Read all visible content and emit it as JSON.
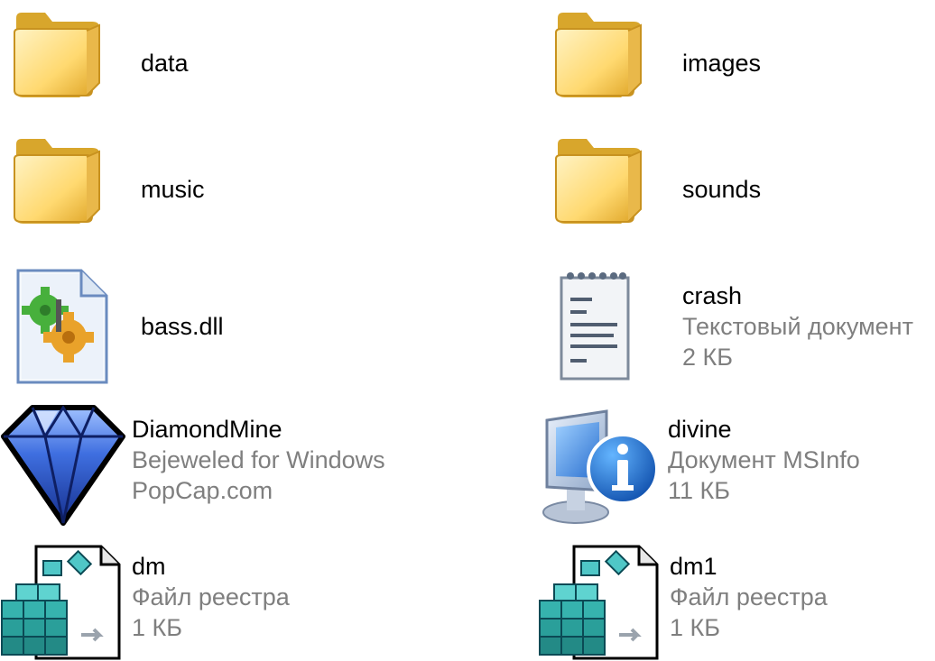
{
  "window": {
    "view": "tiles"
  },
  "colors": {
    "folder_light": "#ffe08a",
    "folder_dark": "#d8a62c",
    "secondary_text": "#7f7f7f",
    "diamond_blue": "#1f48c8",
    "info_blue": "#1565c0"
  },
  "files": [
    {
      "name": "data",
      "type": "",
      "detail": "",
      "icon": "folder-icon"
    },
    {
      "name": "images",
      "type": "",
      "detail": "",
      "icon": "folder-icon"
    },
    {
      "name": "music",
      "type": "",
      "detail": "",
      "icon": "folder-icon"
    },
    {
      "name": "sounds",
      "type": "",
      "detail": "",
      "icon": "folder-icon"
    },
    {
      "name": "bass.dll",
      "type": "",
      "detail": "",
      "icon": "dll-file-icon"
    },
    {
      "name": "crash",
      "type": "Текстовый документ",
      "detail": "2 КБ",
      "icon": "text-document-icon"
    },
    {
      "name": "DiamondMine",
      "type": "Bejeweled for Windows",
      "detail": "PopCap.com",
      "icon": "diamond-icon"
    },
    {
      "name": "divine",
      "type": "Документ MSInfo",
      "detail": "11 КБ",
      "icon": "msinfo-icon"
    },
    {
      "name": "dm",
      "type": "Файл реестра",
      "detail": "1 КБ",
      "icon": "registry-file-icon"
    },
    {
      "name": "dm1",
      "type": "Файл реестра",
      "detail": "1 КБ",
      "icon": "registry-file-icon"
    }
  ]
}
